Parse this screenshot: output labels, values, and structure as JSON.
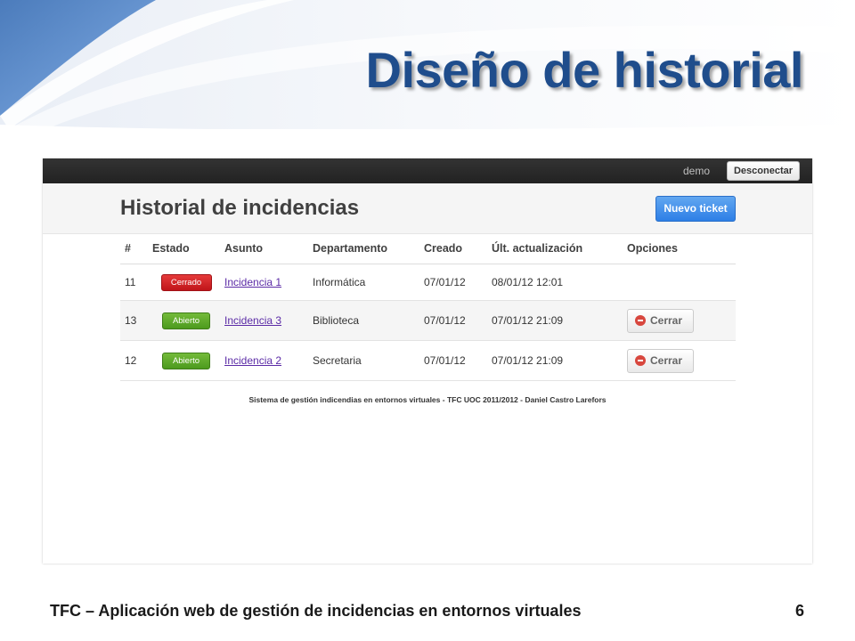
{
  "slide": {
    "title": "Diseño de historial",
    "footer_text": "TFC – Aplicación web de gestión de incidencias  en entornos virtuales",
    "page_number": "6"
  },
  "app": {
    "topbar": {
      "user": "demo",
      "logout_label": "Desconectar"
    },
    "header": {
      "title": "Historial de incidencias",
      "new_ticket_label": "Nuevo ticket"
    },
    "table": {
      "columns": [
        "#",
        "Estado",
        "Asunto",
        "Departamento",
        "Creado",
        "Últ. actualización",
        "Opciones"
      ],
      "rows": [
        {
          "id": "11",
          "estado": "Cerrado",
          "asunto": "Incidencia 1",
          "departamento": "Informática",
          "creado": "07/01/12",
          "actualizacion": "08/01/12 12:01",
          "opcion": ""
        },
        {
          "id": "13",
          "estado": "Abierto",
          "asunto": "Incidencia 3",
          "departamento": "Biblioteca",
          "creado": "07/01/12",
          "actualizacion": "07/01/12 21:09",
          "opcion": "Cerrar"
        },
        {
          "id": "12",
          "estado": "Abierto",
          "asunto": "Incidencia 2",
          "departamento": "Secretaria",
          "creado": "07/01/12",
          "actualizacion": "07/01/12 21:09",
          "opcion": "Cerrar"
        }
      ]
    },
    "footer": "Sistema de gestión indicendias en entornos virtuales - TFC UOC 2011/2012 - Daniel Castro Larefors"
  },
  "colors": {
    "title": "#1f4d8c",
    "badge_closed": "#c0151a",
    "badge_open": "#4c9a1e",
    "primary_button": "#2d7fe6"
  }
}
